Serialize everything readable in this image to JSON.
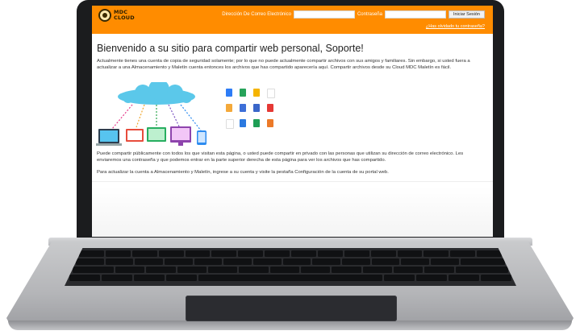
{
  "header": {
    "logo_line1": "MDC",
    "logo_line2": "CLOUD",
    "email_label": "Dirección De Correo Electrónico",
    "email_value": "",
    "password_label": "Contraseña",
    "password_value": "",
    "login_button": "Iniciar Sesión",
    "forgot_link": "¿Has olvidado tu contraseña?"
  },
  "main": {
    "title": "Bienvenido a su sitio para compartir web personal, Soporte!",
    "paragraph1": "Actualmente tienes una cuenta de copia de seguridad solamente; por lo que no puede actualmente compartir archivos con sus amigos y familiares. Sin embargo, si usted fuera a actualizar a una Almacenamiento y Maletín cuenta entonces los archivos que has compartido aparecería aquí. Compartir archivos desde su Cloud MDC Maletín es fácil.",
    "paragraph2": "Puede compartir públicamente con todos los que visitan esta página, o usted puede compartir en privado con las personas que utilizan su dirección de correo electrónico. Les enviaremos una contraseña y que podemos entrar en la parte superior derecha de esta página para ver los archivos que has compartido.",
    "paragraph3": "Para actualizar la cuenta a Almacenamiento y Maletín, ingrese a su cuenta y visite la pestaña Configuración de la cuenta de su portal web."
  },
  "colors": {
    "header_bg": "#ff8c00",
    "cloud": "#5bc8ea",
    "laptop_frame": "#1b1c1e"
  },
  "icons": {
    "logo": "mdc-cloud-logo-icon",
    "illustration_left": "cloud-devices-illustration",
    "illustration_right": "file-type-icons-grid"
  }
}
